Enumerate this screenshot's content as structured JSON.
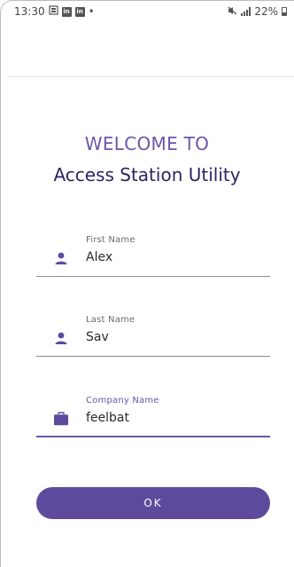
{
  "status_bar": {
    "time": "13:30",
    "icons": [
      "notification-icon",
      "linkedin-icon",
      "linkedin-icon",
      "dot-icon"
    ],
    "badge_text": "in",
    "battery": "22%"
  },
  "welcome": {
    "line1": "WELCOME TO",
    "line2": "Access Station Utility"
  },
  "form": {
    "first_name": {
      "label": "First Name",
      "value": "Alex",
      "icon": "person-icon"
    },
    "last_name": {
      "label": "Last Name",
      "value": "Sav",
      "icon": "person-icon"
    },
    "company_name": {
      "label": "Company Name",
      "value": "feelbat",
      "icon": "briefcase-icon"
    }
  },
  "actions": {
    "ok_label": "OK"
  },
  "colors": {
    "accent": "#6a55a8",
    "button": "#5e4a9d",
    "title_dark": "#2d2460",
    "underline": "#8c8c8c"
  }
}
